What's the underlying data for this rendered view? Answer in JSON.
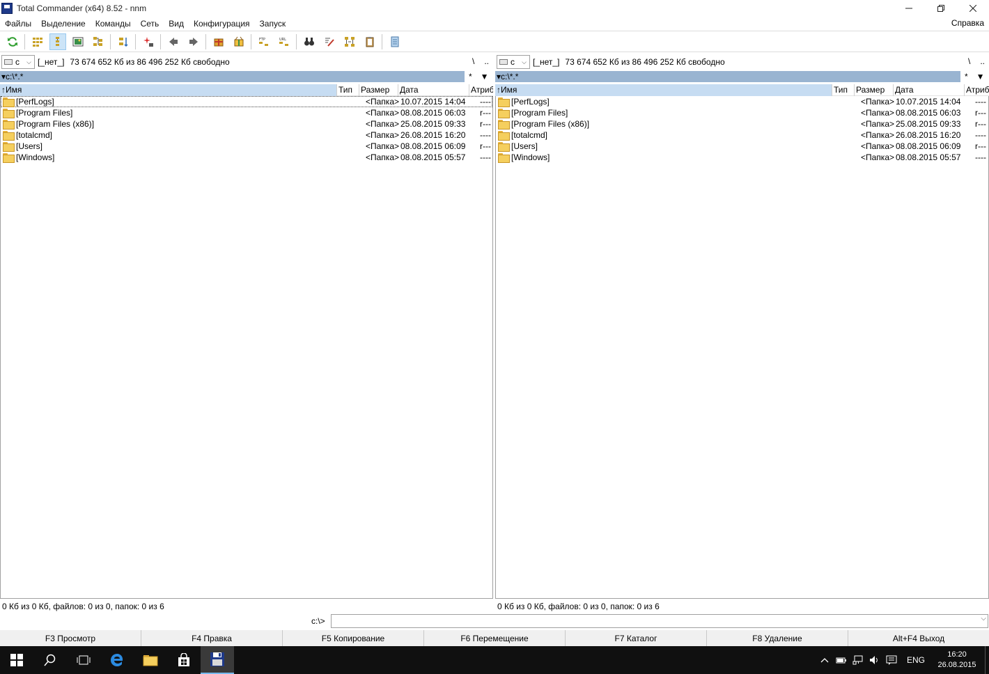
{
  "window": {
    "title": "Total Commander (x64) 8.52 - nnm"
  },
  "menu": {
    "items": [
      "Файлы",
      "Выделение",
      "Команды",
      "Сеть",
      "Вид",
      "Конфигурация",
      "Запуск"
    ],
    "help": "Справка"
  },
  "left": {
    "drive": "c",
    "volume_label": "[_нет_]",
    "free_space": "73 674 652 Кб из 86 496 252 Кб свободно",
    "nav_root": "\\",
    "nav_up": "..",
    "path": "▾c:\\*.*",
    "filter": "*",
    "columns": {
      "name": "↑Имя",
      "ext": "Тип",
      "size": "Размер",
      "date": "Дата",
      "attr": "Атрибуты"
    },
    "status": "0 Кб из 0 Кб, файлов: 0 из 0, папок: 0 из 6"
  },
  "right": {
    "drive": "c",
    "volume_label": "[_нет_]",
    "free_space": "73 674 652 Кб из 86 496 252 Кб свободно",
    "nav_root": "\\",
    "nav_up": "..",
    "path": "▾c:\\*.*",
    "filter": "*",
    "columns": {
      "name": "↑Имя",
      "ext": "Тип",
      "size": "Размер",
      "date": "Дата",
      "attr": "Атрибуты"
    },
    "status": "0 Кб из 0 Кб, файлов: 0 из 0, папок: 0 из 6"
  },
  "files": [
    {
      "name": "[PerfLogs]",
      "size": "<Папка>",
      "date": "10.07.2015 14:04",
      "attr": "----"
    },
    {
      "name": "[Program Files]",
      "size": "<Папка>",
      "date": "08.08.2015 06:03",
      "attr": "r---"
    },
    {
      "name": "[Program Files (x86)]",
      "size": "<Папка>",
      "date": "25.08.2015 09:33",
      "attr": "r---"
    },
    {
      "name": "[totalcmd]",
      "size": "<Папка>",
      "date": "26.08.2015 16:20",
      "attr": "----"
    },
    {
      "name": "[Users]",
      "size": "<Папка>",
      "date": "08.08.2015 06:09",
      "attr": "r---"
    },
    {
      "name": "[Windows]",
      "size": "<Папка>",
      "date": "08.08.2015 05:57",
      "attr": "----"
    }
  ],
  "command": {
    "prompt": "c:\\>",
    "value": ""
  },
  "fkeys": [
    "F3 Просмотр",
    "F4 Правка",
    "F5 Копирование",
    "F6 Перемещение",
    "F7 Каталог",
    "F8 Удаление",
    "Alt+F4 Выход"
  ],
  "taskbar": {
    "language": "ENG",
    "time": "16:20",
    "date": "26.08.2015"
  },
  "colors": {
    "path_bar": "#99b4d1",
    "name_header": "#c6dcf2",
    "taskbar": "#101010",
    "folder": "#f5cf5e"
  }
}
